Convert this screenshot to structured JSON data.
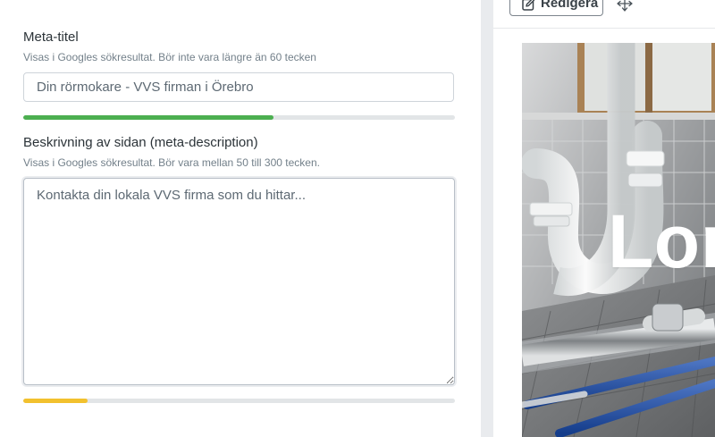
{
  "meta_title": {
    "label": "Meta-titel",
    "help": "Visas i Googles sökresultat. Bör inte vara längre än 60 tecken",
    "placeholder": "Din rörmokare - VVS firman i Örebro",
    "value": "",
    "progress": 0.58,
    "progress_color": "#4caf50"
  },
  "meta_description": {
    "label": "Beskrivning av sidan (meta-description)",
    "help": "Visas i Googles sökresultat. Bör vara mellan 50 till 300 tecken.",
    "placeholder": "Kontakta din lokala VVS firma som du hittar...",
    "value": "",
    "progress": 0.15,
    "progress_color": "#f2c12e"
  },
  "preview": {
    "edit_label": "Redigera",
    "edit_icon": "edit-icon",
    "move_icon": "move-icon",
    "hero_text": "Lor"
  },
  "colors": {
    "track": "#e2e5e7",
    "divider": "#e9ebee"
  }
}
